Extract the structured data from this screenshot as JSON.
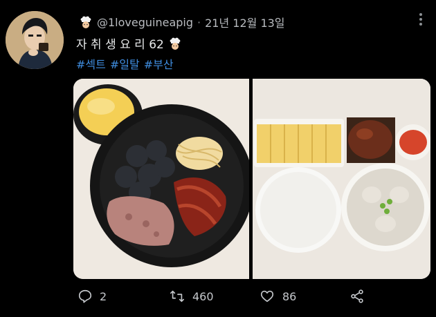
{
  "tweet": {
    "handle": "@1loveguineapig",
    "separator": "·",
    "date": "21년 12월 13일",
    "text": "자 취 생 요 리 62",
    "hashtags": [
      "#섹트",
      "#일탈",
      "#부산"
    ]
  },
  "actions": {
    "reply_count": "2",
    "retweet_count": "460",
    "like_count": "86"
  },
  "colors": {
    "background": "#000000",
    "hashtag": "#3f8ddf",
    "secondary_text": "#b9bcc0"
  },
  "icons": [
    "chef-emoji-icon",
    "more-icon",
    "reply-icon",
    "retweet-icon",
    "like-icon",
    "share-icon"
  ]
}
